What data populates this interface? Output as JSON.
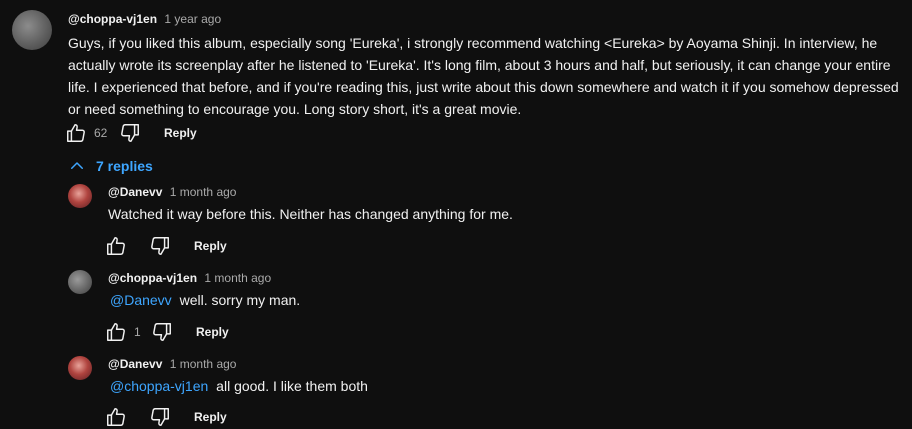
{
  "colors": {
    "background": "#0f0f0f",
    "text": "#f1f1f1",
    "secondary_text": "#aaaaaa",
    "link": "#3ea6ff"
  },
  "top_comment": {
    "author": "@choppa-vj1en",
    "time": "1 year ago",
    "lines": [
      "Guys, if you liked this album, especially song 'Eureka', i strongly recommend watching <Eureka> by Aoyama Shinji. In interview, he",
      "actually wrote its screenplay after he listened to 'Eureka'. It's long film, about 3 hours and half, but seriously, it can change your entire",
      "life. I experienced that before, and if you're reading this, just write about this down somewhere and watch it if you somehow depressed",
      "or need something to encourage you. Long story short, it's a great movie."
    ],
    "like_count": "62",
    "reply_label": "Reply",
    "avatar_icon": "user-avatar-icon"
  },
  "replies_toggle": {
    "label": "7 replies",
    "icon": "chevron-up-icon"
  },
  "replies": [
    {
      "author": "@Danevv",
      "time": "1 month ago",
      "mention": "",
      "text": "Watched it way before this. Neither has changed anything for me.",
      "like_count": "",
      "reply_label": "Reply"
    },
    {
      "author": "@choppa-vj1en",
      "time": "1 month ago",
      "mention": "@Danevv",
      "text": "well. sorry my man.",
      "like_count": "1",
      "reply_label": "Reply"
    },
    {
      "author": "@Danevv",
      "time": "1 month ago",
      "mention": "@choppa-vj1en",
      "text": "all good. I like them both",
      "like_count": "",
      "reply_label": "Reply"
    }
  ],
  "icons": {
    "like": "thumbs-up-icon",
    "dislike": "thumbs-down-icon"
  }
}
